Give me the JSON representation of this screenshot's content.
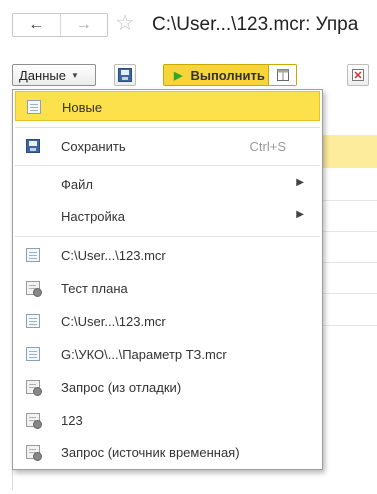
{
  "window": {
    "title": "C:\\User...\\123.mcr: Упра"
  },
  "nav": {
    "back_glyph": "←",
    "forward_glyph": "→",
    "favorite_glyph": "☆"
  },
  "toolbar": {
    "data_label": "Данные",
    "run_label": "Выполнить"
  },
  "menu": {
    "items": [
      {
        "label": "Новые",
        "icon": "document-icon",
        "selected": true
      },
      {
        "label": "Сохранить",
        "icon": "save-icon",
        "shortcut": "Ctrl+S"
      },
      {
        "label": "Файл",
        "submenu": true
      },
      {
        "label": "Настройка",
        "submenu": true
      },
      {
        "label": "C:\\User...\\123.mcr",
        "icon": "document-icon"
      },
      {
        "label": "Тест плана",
        "icon": "query-document-icon"
      },
      {
        "label": "C:\\User...\\123.mcr",
        "icon": "document-icon"
      },
      {
        "label": "G:\\УКО\\...\\Параметр ТЗ.mcr",
        "icon": "document-icon"
      },
      {
        "label": "Запрос (из отладки)",
        "icon": "query-document-icon"
      },
      {
        "label": "123",
        "icon": "query-document-icon"
      },
      {
        "label": "Запрос (источник временная)",
        "icon": "query-document-icon"
      }
    ],
    "submenu_arrow": "▶"
  },
  "colors": {
    "accent_yellow": "#fce04c",
    "run_button": "#f7d53a",
    "play_green": "#2fa82f",
    "save_blue": "#3b66a0"
  }
}
